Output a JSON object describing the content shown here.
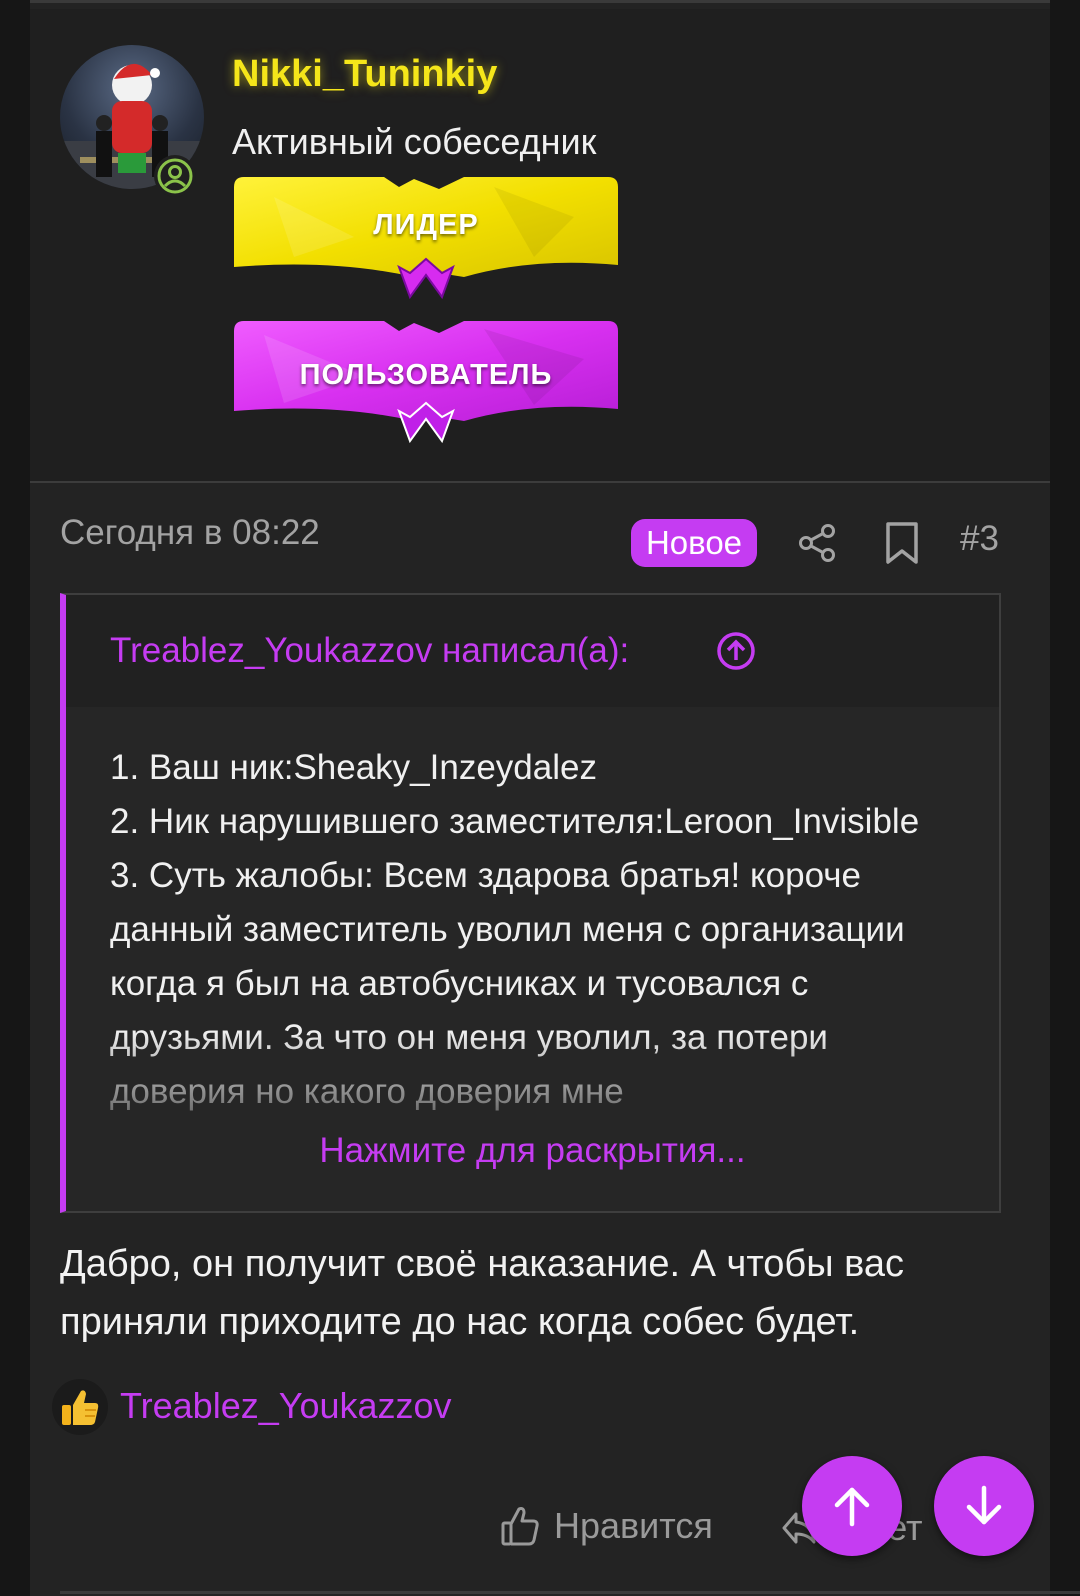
{
  "user": {
    "username": "Nikki_Tuninkiy",
    "title": "Активный собеседник",
    "banners": [
      "ЛИДЕР",
      "ПОЛЬЗОВАТЕЛЬ"
    ]
  },
  "post": {
    "date": "Сегодня в 08:22",
    "new_badge": "Новое",
    "number": "#3"
  },
  "quote": {
    "author": "Treablez_Youkazzov написал(а):",
    "lines": [
      "1. Ваш ник:Sheaky_Inzeydalez",
      "2. Ник нарушившего заместителя:Leroon_Invisible",
      "3. Суть жалобы: Всем здарова братья! короче данный заместитель уволил меня с организации когда я был на автобусниках и тусовался с друзьями. За что он меня уволил, за потери доверия но какого доверия мне"
    ],
    "expand_label": "Нажмите для раскрытия..."
  },
  "reply": {
    "text": "Дабро, он получит своё наказание. А чтобы вас приняли приходите до нас когда собес будет."
  },
  "reactions": {
    "user": "Treablez_Youkazzov"
  },
  "actions": {
    "like_label": "Нравится",
    "reply_label": "Ответ"
  },
  "colors": {
    "accent": "#c53cf2",
    "username": "#f5e61a",
    "status": "#8bc34a"
  },
  "icons": [
    "user-status-icon",
    "share-icon",
    "bookmark-icon",
    "circle-arrow-up-icon",
    "thumbs-up-icon",
    "reply-arrow-icon",
    "arrow-up-icon",
    "arrow-down-icon"
  ]
}
